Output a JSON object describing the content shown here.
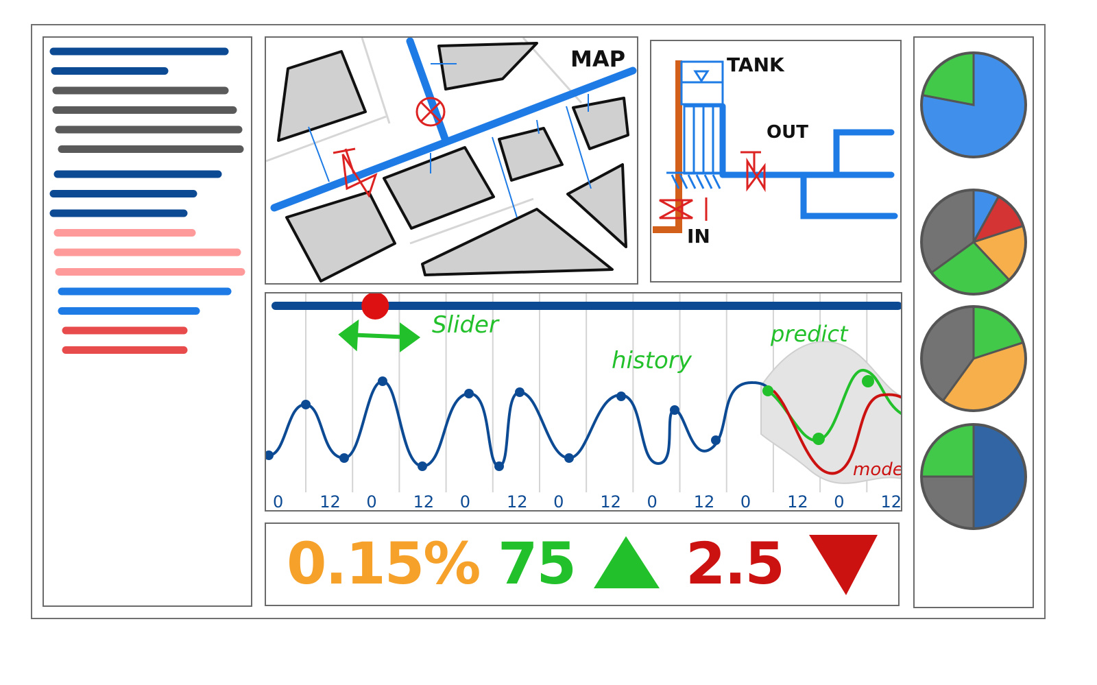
{
  "colors": {
    "navy": "#0d4a94",
    "gray": "#5a5a5a",
    "pink": "#ff9a9a",
    "blue": "#1e7be6",
    "red": "#e84b4b",
    "pipe": "#1e7be6",
    "green": "#22c02a",
    "orange": "#f5a12a",
    "dark_red": "#cc1111",
    "rust": "#d2601a"
  },
  "sidebar": {
    "lines": [
      {
        "color": "navy"
      },
      {
        "color": "navy"
      },
      {
        "color": "gray"
      },
      {
        "color": "gray"
      },
      {
        "color": "gray"
      },
      {
        "color": "gray"
      },
      {
        "color": "navy"
      },
      {
        "color": "navy"
      },
      {
        "color": "navy"
      },
      {
        "color": "pink"
      },
      {
        "color": "pink"
      },
      {
        "color": "pink"
      },
      {
        "color": "blue"
      },
      {
        "color": "blue"
      },
      {
        "color": "red"
      },
      {
        "color": "red"
      }
    ]
  },
  "map": {
    "title": "MAP"
  },
  "tank": {
    "title": "TANK",
    "out_label": "OUT",
    "in_label": "IN"
  },
  "timeline": {
    "slider_label": "Slider",
    "history_label": "history",
    "predict_label": "predict",
    "model_label": "model",
    "tick_labels": [
      "0",
      "12",
      "0",
      "12",
      "0",
      "12",
      "0",
      "12",
      "0",
      "12",
      "0",
      "12",
      "0",
      "12"
    ],
    "slider_position": 0.16
  },
  "kpis": {
    "rate": "0.15%",
    "count": "75",
    "count_trend": "up",
    "delta": "2.5",
    "delta_trend": "down"
  },
  "pies": [
    {
      "slices": [
        {
          "value": 78,
          "color": "blue"
        },
        {
          "value": 22,
          "color": "green"
        }
      ]
    },
    {
      "slices": [
        {
          "value": 8,
          "color": "blue"
        },
        {
          "value": 12,
          "color": "dark_red"
        },
        {
          "value": 18,
          "color": "orange"
        },
        {
          "value": 27,
          "color": "green"
        },
        {
          "value": 35,
          "color": "gray"
        }
      ]
    },
    {
      "slices": [
        {
          "value": 20,
          "color": "green"
        },
        {
          "value": 40,
          "color": "orange"
        },
        {
          "value": 40,
          "color": "gray"
        }
      ]
    },
    {
      "slices": [
        {
          "value": 50,
          "color": "navy"
        },
        {
          "value": 25,
          "color": "gray"
        },
        {
          "value": 25,
          "color": "green"
        }
      ]
    }
  ]
}
